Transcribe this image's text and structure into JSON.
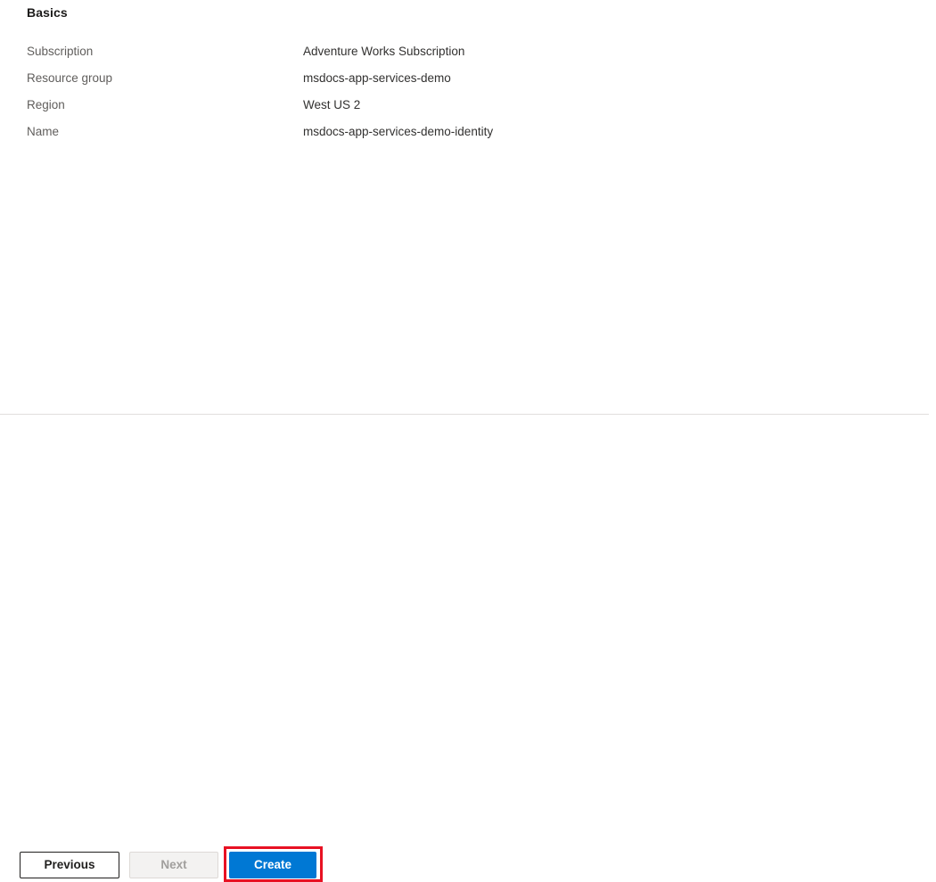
{
  "pane": {
    "section_title": "Basics",
    "rows": [
      {
        "label": "Subscription",
        "value": "Adventure Works Subscription"
      },
      {
        "label": "Resource group",
        "value": "msdocs-app-services-demo"
      },
      {
        "label": "Region",
        "value": "West US 2"
      },
      {
        "label": "Name",
        "value": "msdocs-app-services-demo-identity"
      }
    ]
  },
  "footer": {
    "previous_label": "Previous",
    "next_label": "Next",
    "create_label": "Create"
  },
  "colors": {
    "accent_blue": "#0078d4",
    "highlight_red": "#e81123",
    "label_gray": "#605e5c",
    "value_dark": "#323130",
    "disabled_text": "#a19f9d",
    "divider": "#e1dfdd",
    "disabled_fill": "#f3f2f1"
  }
}
